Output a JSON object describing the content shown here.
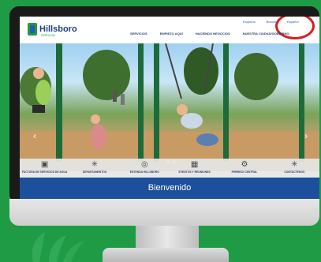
{
  "header": {
    "logo_text": "Hillsboro",
    "logo_sub": "OREGON",
    "top_links": [
      "Empleos",
      "Buscar",
      "Español"
    ],
    "nav": [
      "SERVICIOS",
      "EMPIEZO AQUÍ",
      "HACIENDO NEGOCIOS",
      "NUESTRA CIUDAD/GOBIERNO"
    ]
  },
  "hero": {
    "prev_icon": "chevron-left-icon",
    "next_icon": "chevron-right-icon"
  },
  "quick_links": [
    {
      "label": "FACTURA DE SERVICIOS DE AGUA",
      "icon": "monitor-icon"
    },
    {
      "label": "DEPARTAMENTOS",
      "icon": "network-icon"
    },
    {
      "label": "ENTENDA HILLSBORO",
      "icon": "compass-icon"
    },
    {
      "label": "EVENTOS Y REUNIONES",
      "icon": "calendar-icon"
    },
    {
      "label": "PERMISO CENTRAL",
      "icon": "gear-icon"
    },
    {
      "label": "CONTACTENOS",
      "icon": "network-icon"
    }
  ],
  "welcome": {
    "text": "Bienvenido"
  },
  "colors": {
    "brand_green": "#1f9b45",
    "brand_blue": "#1c4f9c",
    "highlight_red": "#d61f1f"
  }
}
